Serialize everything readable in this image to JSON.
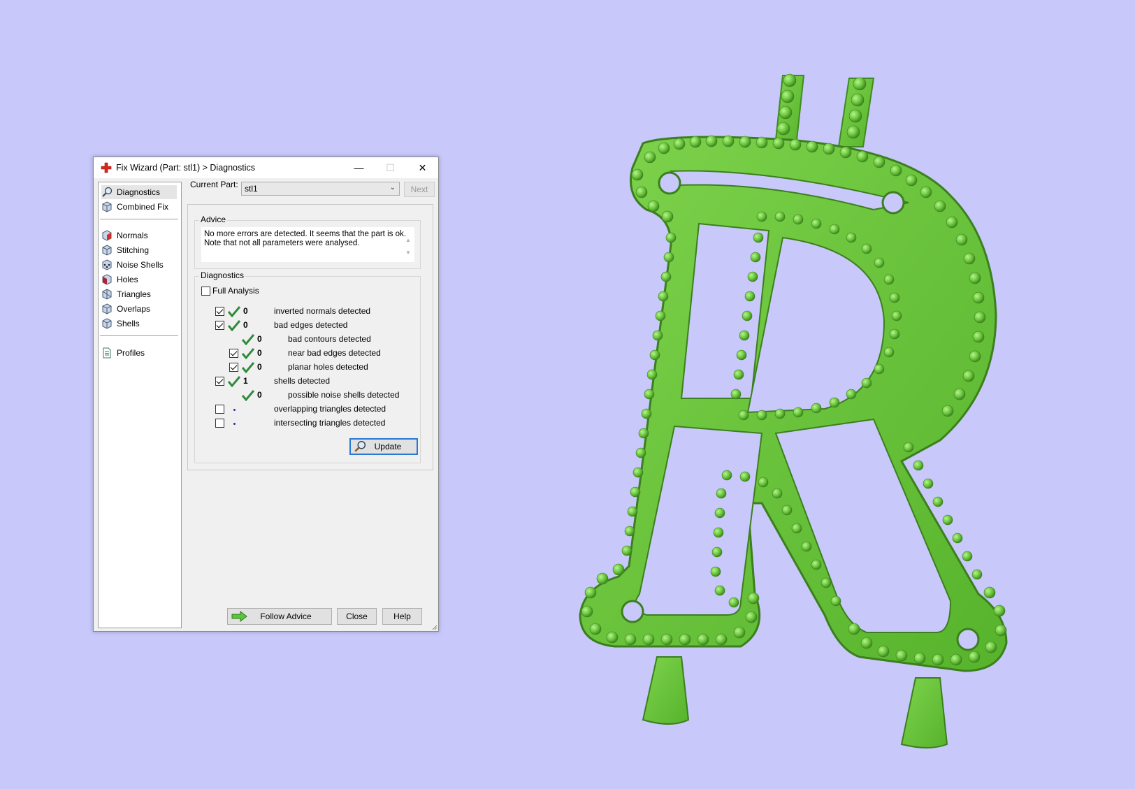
{
  "window": {
    "title": "Fix Wizard (Part: stl1) > Diagnostics",
    "minimize_glyph": "—",
    "maximize_glyph": "☐",
    "close_glyph": "✕",
    "title_icon": "red-cross-icon"
  },
  "nav": {
    "items": [
      {
        "label": "Diagnostics",
        "icon": "magnifier-icon",
        "selected": true
      },
      {
        "label": "Combined Fix",
        "icon": "cube-icon"
      },
      {
        "label": "Normals",
        "icon": "cube-red-icon"
      },
      {
        "label": "Stitching",
        "icon": "cube-icon"
      },
      {
        "label": "Noise Shells",
        "icon": "cube-dots-icon"
      },
      {
        "label": "Holes",
        "icon": "cube-hole-icon"
      },
      {
        "label": "Triangles",
        "icon": "triangle-cube-icon"
      },
      {
        "label": "Overlaps",
        "icon": "cube-icon"
      },
      {
        "label": "Shells",
        "icon": "cube-icon"
      },
      {
        "label": "Profiles",
        "icon": "document-icon"
      }
    ]
  },
  "current_part": {
    "label": "Current Part:",
    "value": "stl1",
    "next_label": "Next"
  },
  "advice": {
    "title": "Advice",
    "line1": "No more errors are detected. It seems that the part is ok.",
    "line2": "Note that not all parameters were analysed."
  },
  "diagnostics": {
    "title": "Diagnostics",
    "full_analysis_label": "Full Analysis",
    "full_analysis_checked": false,
    "rows": [
      {
        "checked": true,
        "status": "ok",
        "count": "0",
        "label": "inverted normals detected",
        "indent": 0
      },
      {
        "checked": true,
        "status": "ok",
        "count": "0",
        "label": "bad edges detected",
        "indent": 0
      },
      {
        "checked": null,
        "status": "ok",
        "count": "0",
        "label": "bad contours detected",
        "indent": 1
      },
      {
        "checked": true,
        "status": "ok",
        "count": "0",
        "label": "near bad edges detected",
        "indent": 1
      },
      {
        "checked": true,
        "status": "ok",
        "count": "0",
        "label": "planar holes detected",
        "indent": 1
      },
      {
        "checked": true,
        "status": "ok",
        "count": "1",
        "label": "shells detected",
        "indent": 0
      },
      {
        "checked": null,
        "status": "ok",
        "count": "0",
        "label": "possible noise shells detected",
        "indent": 1
      },
      {
        "checked": false,
        "status": "none",
        "count": "",
        "label": "overlapping triangles detected",
        "indent": 0
      },
      {
        "checked": false,
        "status": "none",
        "count": "",
        "label": "intersecting triangles detected",
        "indent": 0
      }
    ],
    "update_label": "Update"
  },
  "footer": {
    "follow_advice_label": "Follow Advice",
    "close_label": "Close",
    "help_label": "Help"
  },
  "colors": {
    "background": "#c8c8fa",
    "model_green": "#6ec63e",
    "check_green": "#2e8b3a",
    "focus_blue": "#2a78d6"
  }
}
